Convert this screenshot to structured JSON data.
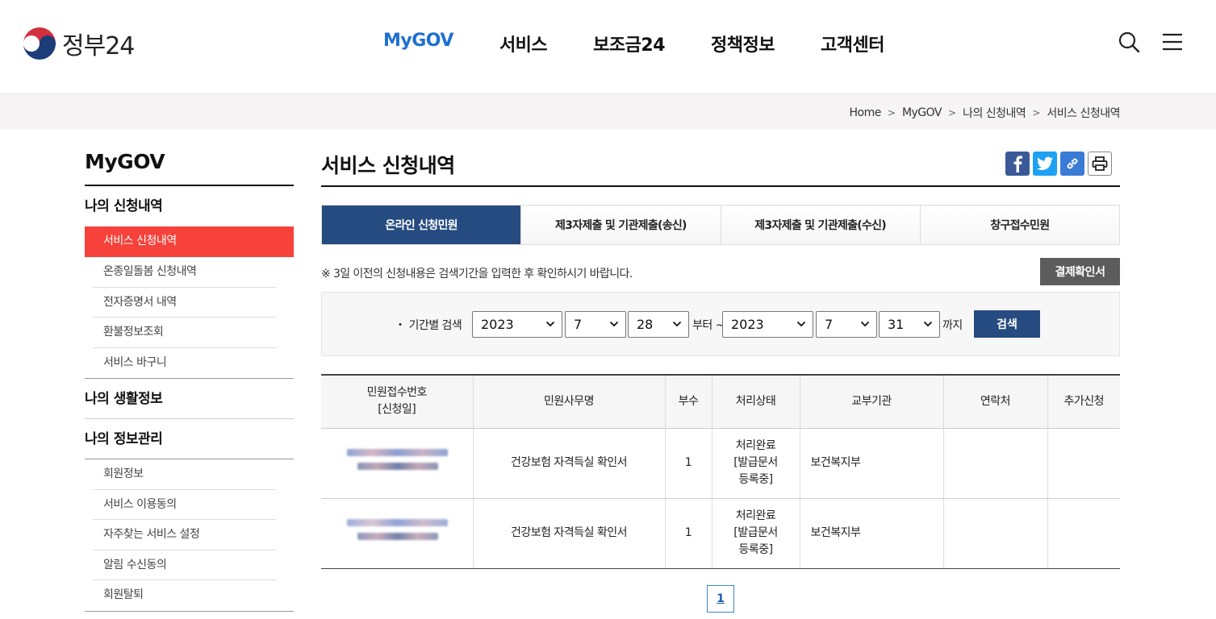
{
  "header": {
    "logo_text": "정부24",
    "nav": [
      "MyGOV",
      "서비스",
      "보조금24",
      "정책정보",
      "고객센터"
    ],
    "active_nav": "MyGOV",
    "accent_color": "#1f6fd1"
  },
  "breadcrumb": [
    "Home",
    "MyGOV",
    "나의 신청내역",
    "서비스 신청내역"
  ],
  "sidebar": {
    "title": "MyGOV",
    "groups": [
      {
        "label": "나의 신청내역",
        "items": [
          "서비스 신청내역",
          "온종일돌봄 신청내역",
          "전자증명서 내역",
          "환불정보조회",
          "서비스 바구니"
        ]
      },
      {
        "label": "나의 생활정보",
        "items": []
      },
      {
        "label": "나의 정보관리",
        "items": [
          "회원정보",
          "서비스 이용동의",
          "자주찾는 서비스 설정",
          "알림 수신동의",
          "회원탈퇴"
        ]
      }
    ],
    "active_item": "서비스 신청내역",
    "active_color": "#f6423a"
  },
  "content": {
    "title": "서비스 신청내역",
    "tabs": [
      "온라인 신청민원",
      "제3자제출 및 기관제출(송신)",
      "제3자제출 및 기관제출(수신)",
      "창구접수민원"
    ],
    "active_tab": "온라인 신청민원",
    "notice": "※ 3일 이전의 신청내용은 검색기간을 입력한 후 확인하시기 바랍니다.",
    "payment_button": "결제확인서",
    "search": {
      "label": "・ 기간별 검색",
      "from_year": "2023",
      "from_month": "7",
      "from_day": "28",
      "from_suffix": "부터 ~",
      "to_year": "2023",
      "to_month": "7",
      "to_day": "31",
      "to_suffix": "까지",
      "button": "검색"
    },
    "table": {
      "headers": [
        "민원접수번호\n[신청일]",
        "민원사무명",
        "부수",
        "처리상태",
        "교부기관",
        "연락처",
        "추가신청"
      ],
      "rows": [
        {
          "name": "건강보험 자격득실 확인서",
          "copies": "1",
          "status": "처리완료\n[발급문서\n등록중]",
          "agency": "보건복지부",
          "contact": "",
          "extra": ""
        },
        {
          "name": "건강보험 자격득실 확인서",
          "copies": "1",
          "status": "처리완료\n[발급문서\n등록중]",
          "agency": "보건복지부",
          "contact": "",
          "extra": ""
        }
      ]
    },
    "pagination": {
      "current": "1"
    }
  }
}
